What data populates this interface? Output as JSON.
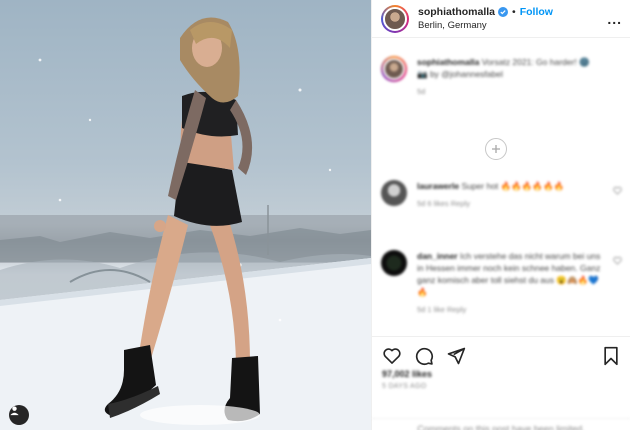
{
  "post": {
    "username": "sophiathomalla",
    "follow_label": "Follow",
    "separator": "•",
    "location": "Berlin, Germany",
    "more_label": "..."
  },
  "caption": {
    "username": "sophiathomalla",
    "text": "Vorsatz 2021: Go harder! 🌚",
    "credit": "📷 by @johannesfabel",
    "time": "5d"
  },
  "comments": [
    {
      "username": "laurawerle",
      "text": "Super hot 🔥🔥🔥🔥🔥🔥",
      "meta": "5d  6 likes  Reply"
    },
    {
      "username": "dan_inner",
      "text": "Ich verstehe das nicht warum bei uns in Hessen immer noch kein schnee haben. Ganz ganz komisch aber toll siehst du aus 😮🙈🔥💙🔥",
      "meta": "5d  1 like  Reply"
    }
  ],
  "likes_text": "97,002 likes",
  "posted_text": "5 DAYS AGO",
  "limited_text": "Comments on this post have been limited.",
  "icons": {
    "verified": "verified-badge-icon",
    "more": "more-options-icon",
    "like": "heart-icon",
    "comment": "comment-icon",
    "share": "paper-plane-icon",
    "save": "bookmark-icon",
    "load_more": "plus-circle-icon",
    "tag": "user-tag-icon"
  },
  "colors": {
    "accent": "#0095f6",
    "text": "#262626",
    "muted": "#8e8e8e",
    "border": "#efefef"
  }
}
